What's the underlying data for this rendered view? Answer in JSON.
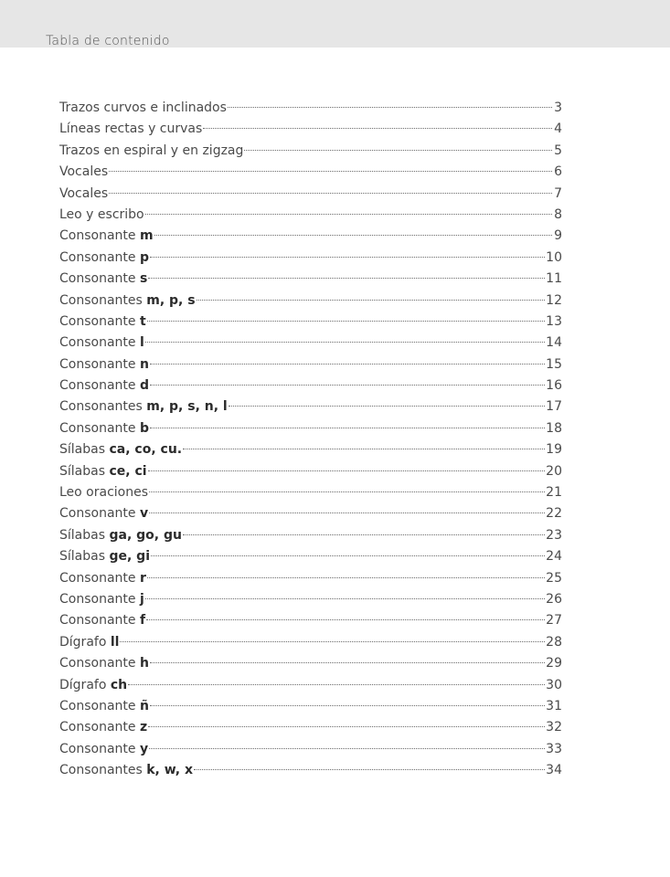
{
  "header": {
    "title": "Tabla de contenido"
  },
  "entries": [
    {
      "label": "Trazos curvos e inclinados",
      "bold": "",
      "page": "3"
    },
    {
      "label": "Líneas rectas y curvas ",
      "bold": "",
      "page": "4"
    },
    {
      "label": "Trazos en espiral y en zigzag ",
      "bold": "",
      "page": "5"
    },
    {
      "label": "Vocales",
      "bold": "",
      "page": "6"
    },
    {
      "label": "Vocales",
      "bold": "",
      "page": "7"
    },
    {
      "label": "Leo y escribo",
      "bold": "",
      "page": "8"
    },
    {
      "label": "Consonante ",
      "bold": "m",
      "page": "9"
    },
    {
      "label": "Consonante ",
      "bold": "p",
      "page": "10"
    },
    {
      "label": "Consonante ",
      "bold": "s",
      "page": "11"
    },
    {
      "label": "Consonantes ",
      "bold": "m, p, s",
      "page": "12"
    },
    {
      "label": "Consonante ",
      "bold": "t",
      "page": "13"
    },
    {
      "label": "Consonante ",
      "bold": "l",
      "page": "14"
    },
    {
      "label": "Consonante ",
      "bold": "n",
      "page": "15"
    },
    {
      "label": "Consonante ",
      "bold": "d",
      "page": "16"
    },
    {
      "label": "Consonantes ",
      "bold": "m, p, s, n, l",
      "page": "17"
    },
    {
      "label": "Consonante ",
      "bold": "b",
      "page": "18"
    },
    {
      "label": "Sílabas ",
      "bold": "ca, co, cu.",
      "page": "19"
    },
    {
      "label": "Sílabas ",
      "bold": "ce, ci",
      "page": "20"
    },
    {
      "label": "Leo oraciones",
      "bold": "",
      "page": "21"
    },
    {
      "label": "Consonante ",
      "bold": "v",
      "page": "22"
    },
    {
      "label": "Sílabas ",
      "bold": "ga, go, gu",
      "page": "23"
    },
    {
      "label": "Sílabas ",
      "bold": "ge, gi",
      "page": "24"
    },
    {
      "label": "Consonante ",
      "bold": "r",
      "page": "25"
    },
    {
      "label": "Consonante ",
      "bold": "j",
      "page": "26"
    },
    {
      "label": "Consonante ",
      "bold": "f",
      "page": "27"
    },
    {
      "label": "Dígrafo ",
      "bold": "ll",
      "page": "28"
    },
    {
      "label": "Consonante ",
      "bold": "h",
      "page": "29"
    },
    {
      "label": "Dígrafo ",
      "bold": "ch",
      "page": "30"
    },
    {
      "label": "Consonante ",
      "bold": "ñ",
      "page": "31"
    },
    {
      "label": "Consonante ",
      "bold": "z",
      "page": "32"
    },
    {
      "label": "Consonante ",
      "bold": "y",
      "page": "33"
    },
    {
      "label": "Consonantes ",
      "bold": "k, w, x",
      "page": "34"
    }
  ]
}
